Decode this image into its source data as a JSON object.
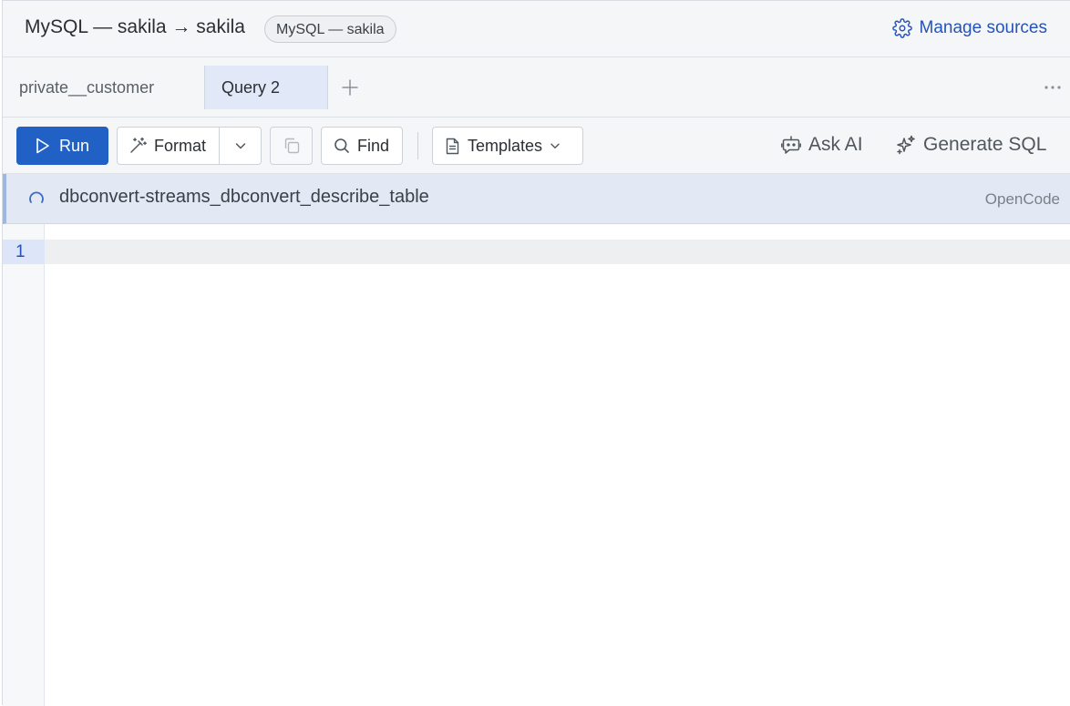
{
  "header": {
    "title": "MySQL — sakila → sakila",
    "connection_pill": "MySQL — sakila",
    "manage_sources_label": "Manage sources",
    "manage_sources_icon": "gear-icon"
  },
  "tabs": {
    "items": [
      {
        "label": "private__customer",
        "active": false
      },
      {
        "label": "Query 2",
        "active": true
      }
    ],
    "add_icon": "plus-icon",
    "more_icon": "more-horizontal-icon"
  },
  "toolbar": {
    "run_label": "Run",
    "format_label": "Format",
    "find_label": "Find",
    "templates_label": "Templates",
    "ask_ai_label": "Ask AI",
    "generate_sql_label": "Generate SQL"
  },
  "status": {
    "text": "dbconvert-streams_dbconvert_describe_table",
    "source": "OpenCode",
    "icon": "spinner-icon"
  },
  "editor": {
    "line_numbers": [
      "1"
    ],
    "content": ""
  },
  "colors": {
    "accent": "#2160c4",
    "link": "#2553b8",
    "status_bg": "#e3e9f4",
    "active_tab_bg": "#e1e9f8"
  }
}
